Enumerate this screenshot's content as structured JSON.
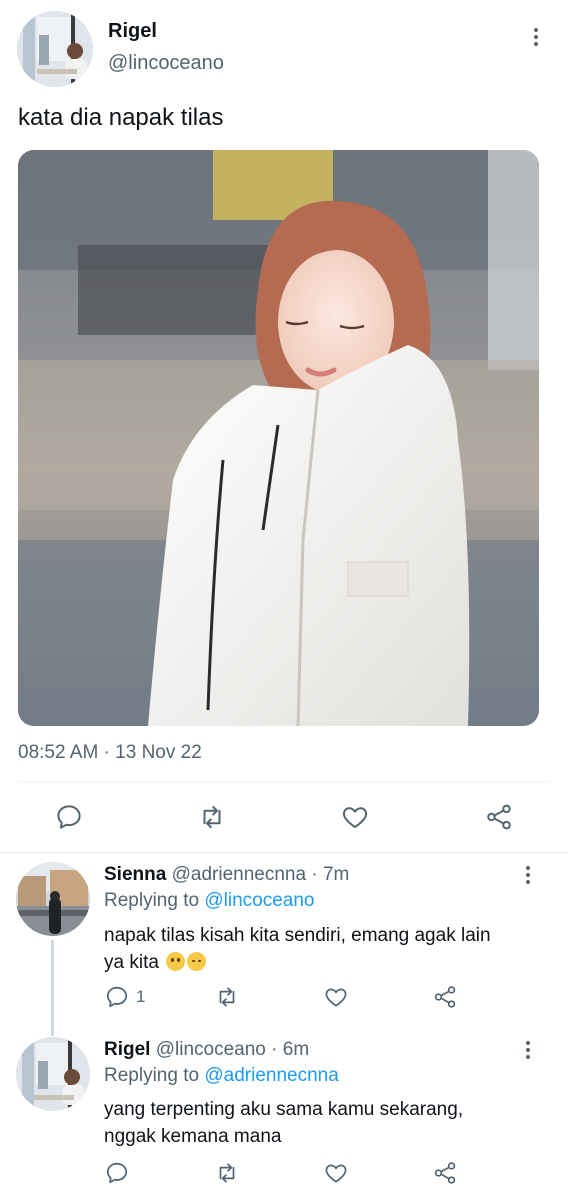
{
  "main_tweet": {
    "author_name": "Rigel",
    "author_handle": "@lincoceano",
    "text": "kata dia napak tilas",
    "timestamp": "08:52 AM · 13 Nov 22",
    "actions": {
      "reply_icon": "speech-bubble-icon",
      "retweet_icon": "retweet-arrows-icon",
      "like_icon": "heart-icon",
      "share_icon": "share-nodes-icon"
    }
  },
  "replies": [
    {
      "author_name": "Sienna",
      "author_handle": "@adriennecnna",
      "time": "7m",
      "replying_prefix": "Replying to",
      "replying_to": "@lincoceano",
      "text_line1": "napak tilas kisah kita sendiri, emang agak lain",
      "text_line2": "ya kita",
      "emojis": [
        "pleading-face-emoji",
        "disappointed-face-emoji"
      ],
      "reply_count": "1"
    },
    {
      "author_name": "Rigel",
      "author_handle": "@lincoceano",
      "time": "6m",
      "replying_prefix": "Replying to",
      "replying_to": "@adriennecnna",
      "text_line1": "yang terpenting aku sama kamu sekarang,",
      "text_line2": "nggak kemana mana",
      "reply_count": ""
    }
  ],
  "colors": {
    "text_primary": "#0f1419",
    "text_secondary": "#536471",
    "accent": "#1d9bf0",
    "divider": "#eff3f4"
  }
}
